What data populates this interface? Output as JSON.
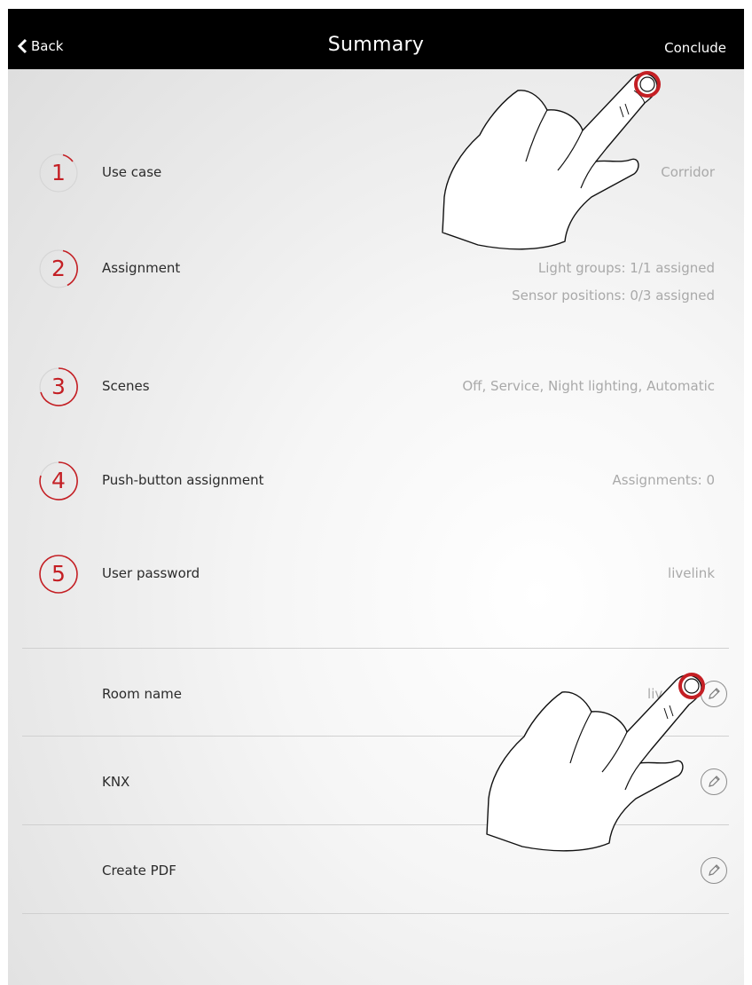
{
  "header": {
    "back_label": "Back",
    "title": "Summary",
    "conclude_label": "Conclude"
  },
  "steps": [
    {
      "number": "1",
      "label": "Use case",
      "value": "Corridor"
    },
    {
      "number": "2",
      "label": "Assignment",
      "value": "Light groups: 1/1 assigned",
      "value2": "Sensor positions: 0/3 assigned"
    },
    {
      "number": "3",
      "label": "Scenes",
      "value": "Off, Service, Night lighting, Automatic"
    },
    {
      "number": "4",
      "label": "Push-button assignment",
      "value": "Assignments: 0"
    },
    {
      "number": "5",
      "label": "User password",
      "value": "livelink"
    }
  ],
  "settings": [
    {
      "label": "Room name",
      "value": "livelink"
    },
    {
      "label": "KNX",
      "value": ""
    },
    {
      "label": "Create PDF",
      "value": ""
    }
  ],
  "colors": {
    "accent": "#c41f24",
    "header_bg": "#000000",
    "label_text": "#2b2b2b",
    "value_text": "#a9a9a9"
  },
  "icons": {
    "back": "chevron-left-icon",
    "edit": "pencil-icon",
    "gesture": "tap-hand-icon"
  }
}
